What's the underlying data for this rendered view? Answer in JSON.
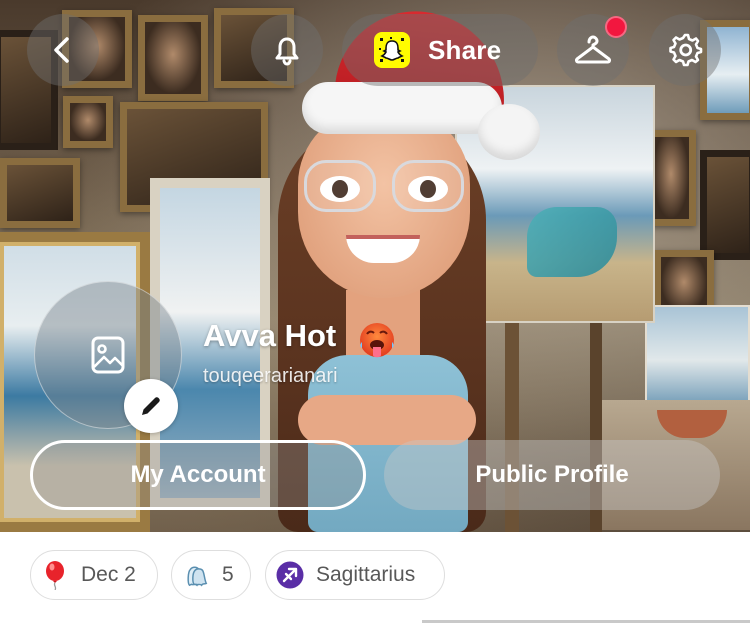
{
  "header": {
    "share_label": "Share",
    "icons": [
      "chevron-left-icon",
      "bell-icon",
      "snapcode-icon",
      "hanger-icon",
      "gear-icon"
    ],
    "notification_dot_color": "#f2173f"
  },
  "profile": {
    "display_name": "Avva Hot",
    "name_emoji": "hot-face-emoji",
    "username": "touqeerarianari"
  },
  "actions": {
    "my_account_label": "My Account",
    "public_profile_label": "Public Profile"
  },
  "chips": {
    "birthday": {
      "icon": "balloon-icon",
      "label": "Dec 2"
    },
    "friends": {
      "icon": "ghost-friends-icon",
      "label": "5"
    },
    "zodiac": {
      "icon": "sagittarius-icon",
      "label": "Sagittarius"
    }
  },
  "colors": {
    "snap_yellow": "#fffc00",
    "zodiac_purple": "#5a2ea6",
    "balloon_red": "#e8232b"
  }
}
